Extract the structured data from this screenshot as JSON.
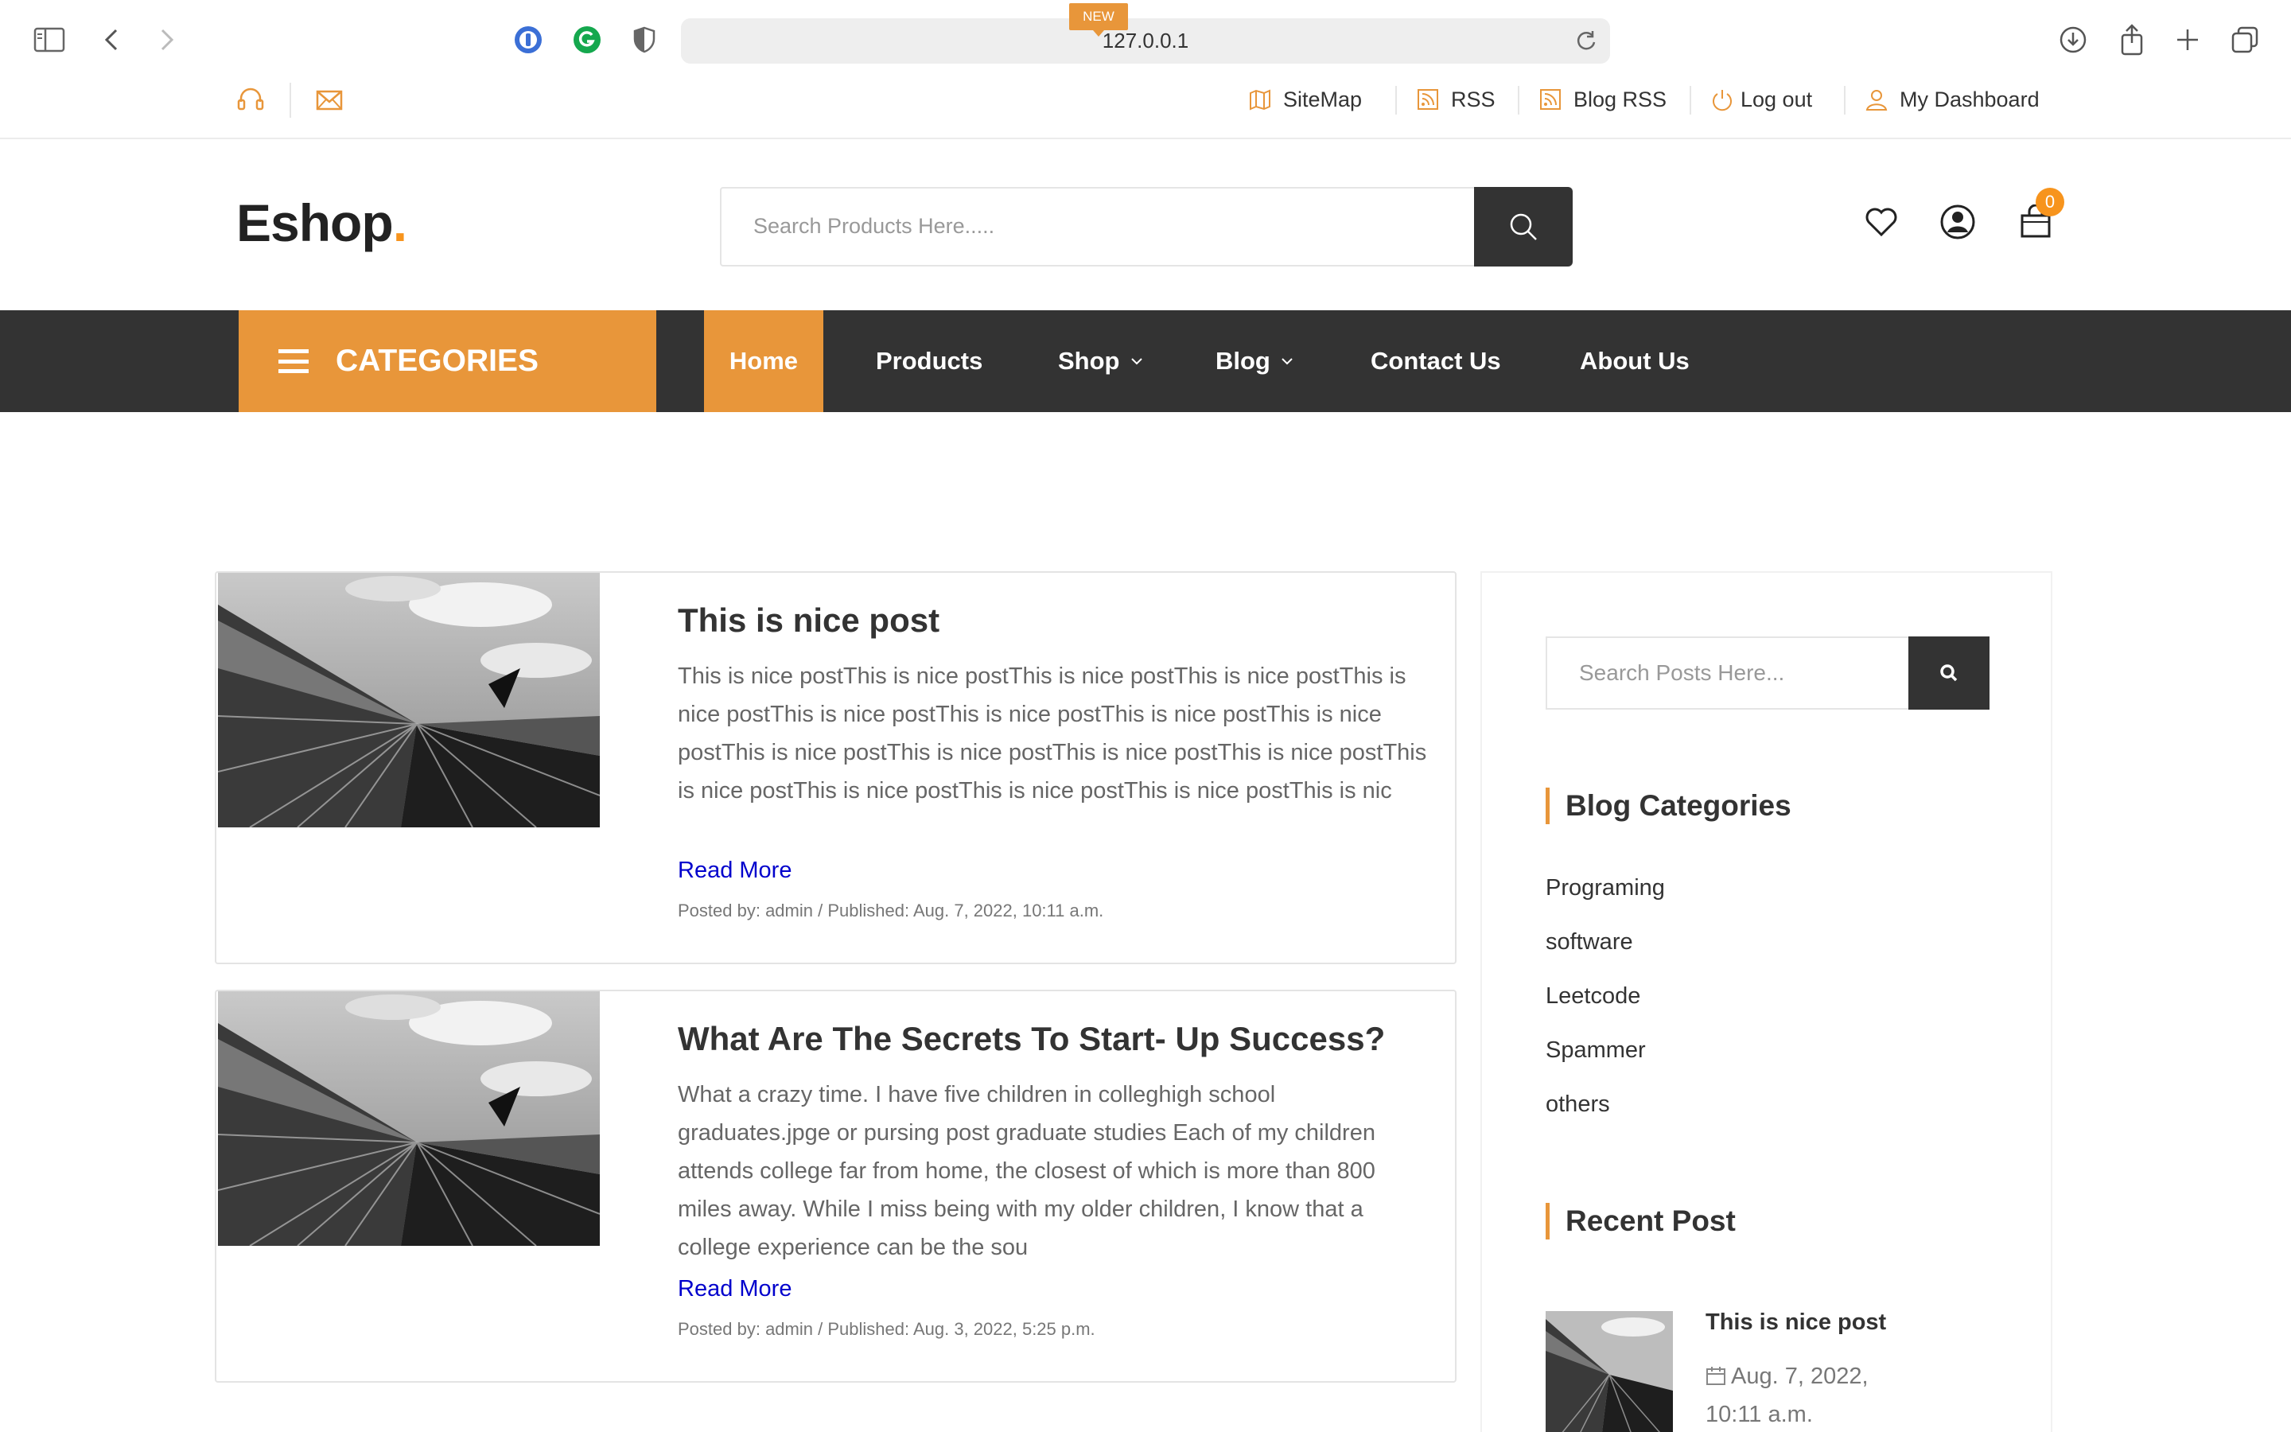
{
  "browser": {
    "url": "127.0.0.1"
  },
  "topbar": {
    "links": [
      {
        "label": "SiteMap",
        "icon": "map-icon"
      },
      {
        "label": "RSS",
        "icon": "rss-icon"
      },
      {
        "label": "Blog RSS",
        "icon": "rss-icon"
      },
      {
        "label": "Log out",
        "icon": "power-icon"
      },
      {
        "label": "My Dashboard",
        "icon": "user-icon"
      }
    ]
  },
  "header": {
    "logo": "Eshop",
    "logo_dot": ".",
    "search_placeholder": "Search Products Here.....",
    "cart_count": "0"
  },
  "nav": {
    "categories_label": "CATEGORIES",
    "items": [
      {
        "label": "Home",
        "active": true
      },
      {
        "label": "Products"
      },
      {
        "label": "Shop",
        "badge": "NEW",
        "dropdown": true
      },
      {
        "label": "Blog",
        "dropdown": true
      },
      {
        "label": "Contact Us"
      },
      {
        "label": "About Us"
      }
    ]
  },
  "posts": [
    {
      "title": "This is nice post",
      "excerpt": "This is nice postThis is nice postThis is nice postThis is nice postThis is nice postThis is nice postThis is nice postThis is nice postThis is nice postThis is nice postThis is nice postThis is nice postThis is nice postThis is nice postThis is nice postThis is nice postThis is nice postThis is nic",
      "read_more": "Read More",
      "meta": "Posted by: admin / Published: Aug. 7, 2022, 10:11 a.m."
    },
    {
      "title": "What Are The Secrets To Start- Up Success?",
      "excerpt": "What a crazy time. I have five children in colleghigh school graduates.jpge or pursing post graduate studies Each of my children attends college far from home, the closest of which is more than 800 miles away. While I miss being with my older children, I know that a college experience can be the sou",
      "read_more": "Read More",
      "meta": "Posted by: admin / Published: Aug. 3, 2022, 5:25 p.m."
    }
  ],
  "sidebar": {
    "search_placeholder": "Search Posts Here...",
    "categories_heading": "Blog Categories",
    "categories": [
      "Programing",
      "software",
      "Leetcode",
      "Spammer",
      "others"
    ],
    "recent_heading": "Recent Post",
    "recent": {
      "title": "This is nice post",
      "date": "Aug. 7, 2022, 10:11 a.m."
    }
  },
  "colors": {
    "accent": "#e8963a",
    "dark": "#333333",
    "link": "#0000cc"
  }
}
